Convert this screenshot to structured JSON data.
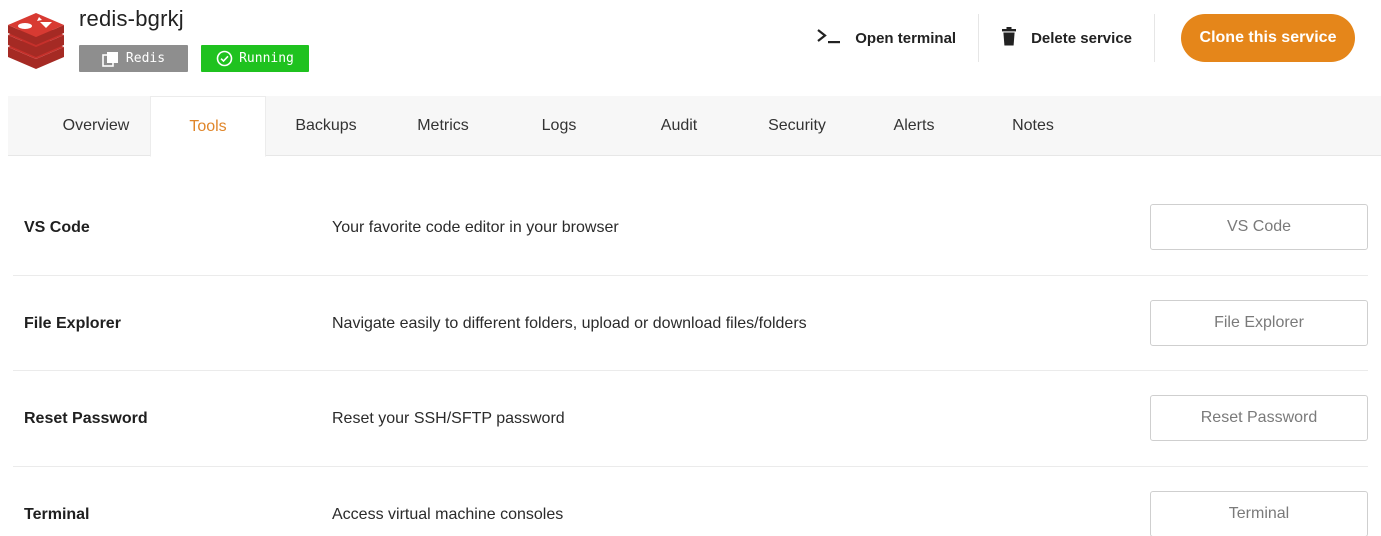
{
  "service": {
    "name": "redis-bgrkj",
    "type_badge": "Redis",
    "status_badge": "Running",
    "colors": {
      "type_badge_bg": "#8e8e8e",
      "status_badge_bg": "#1fc21f",
      "logo_red": "#c6302b"
    }
  },
  "actions": {
    "open_terminal": "Open terminal",
    "delete_service": "Delete service",
    "clone_service": "Clone this service",
    "accent_color": "#e5861a"
  },
  "tabs": [
    {
      "label": "Overview",
      "active": false
    },
    {
      "label": "Tools",
      "active": true
    },
    {
      "label": "Backups",
      "active": false
    },
    {
      "label": "Metrics",
      "active": false
    },
    {
      "label": "Logs",
      "active": false
    },
    {
      "label": "Audit",
      "active": false
    },
    {
      "label": "Security",
      "active": false
    },
    {
      "label": "Alerts",
      "active": false
    },
    {
      "label": "Notes",
      "active": false
    }
  ],
  "tools": [
    {
      "title": "VS Code",
      "description": "Your favorite code editor in your browser",
      "button": "VS Code"
    },
    {
      "title": "File Explorer",
      "description": "Navigate easily to different folders, upload or download files/folders",
      "button": "File Explorer"
    },
    {
      "title": "Reset Password",
      "description": "Reset your SSH/SFTP password",
      "button": "Reset Password"
    },
    {
      "title": "Terminal",
      "description": "Access virtual machine consoles",
      "button": "Terminal"
    }
  ]
}
